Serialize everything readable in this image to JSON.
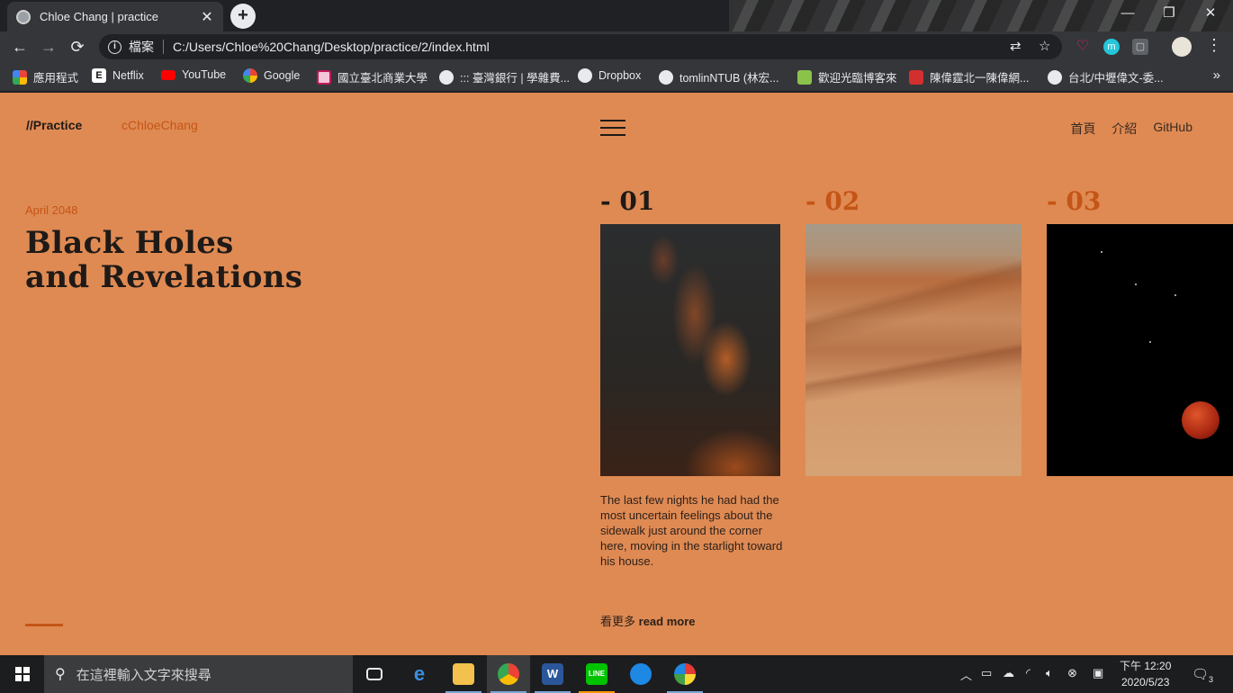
{
  "browser": {
    "tab_title": "Chloe Chang | practice",
    "tab_close": "✕",
    "new_tab": "+",
    "scheme_label": "檔案",
    "url": "C:/Users/Chloe%20Chang/Desktop/practice/2/index.html",
    "window_controls": {
      "minimize": "—",
      "restore": "❐",
      "close": "✕"
    },
    "nav": {
      "back": "←",
      "forward": "→",
      "reload": "⟳"
    },
    "omni_icons": {
      "translate": "⇄",
      "star": "☆"
    },
    "extensions": {
      "heart": "♡",
      "m": "m",
      "square": "▢",
      "menu": "⋮"
    },
    "bookmarks": [
      {
        "label": "應用程式",
        "icon": "apps-grid-icon",
        "color": "#e8453c"
      },
      {
        "label": "Netflix",
        "icon": "netflix-icon",
        "color": "#ffffff"
      },
      {
        "label": "YouTube",
        "icon": "youtube-icon",
        "color": "#ff0000"
      },
      {
        "label": "Google",
        "icon": "google-icon",
        "color": "#4285f4"
      },
      {
        "label": "國立臺北商業大學",
        "icon": "ntub-icon",
        "color": "#c2185b"
      },
      {
        "label": "::: 臺灣銀行 | 學雜費...",
        "icon": "globe-icon",
        "color": "#e8eaed"
      },
      {
        "label": "Dropbox",
        "icon": "globe-icon",
        "color": "#e8eaed"
      },
      {
        "label": "tomlinNTUB (林宏...",
        "icon": "github-icon",
        "color": "#e8eaed"
      },
      {
        "label": "歡迎光臨博客來",
        "icon": "books-icon",
        "color": "#8bc34a"
      },
      {
        "label": "陳偉霆北一陳偉網...",
        "icon": "bookmark-red-icon",
        "color": "#d32f2f"
      },
      {
        "label": "台北/中壢偉文-委...",
        "icon": "globe-icon",
        "color": "#e8eaed"
      }
    ],
    "bookmarks_more": "»"
  },
  "site": {
    "logo": "//Practice",
    "author": "cChloeChang",
    "nav": [
      "首頁",
      "介紹",
      "GitHub"
    ],
    "date": "April 2048",
    "headline_line1": "Black Holes",
    "headline_line2": "and Revelations",
    "cards": [
      {
        "number": "- 01",
        "image": "milky-way-galaxy",
        "number_color": "#1f1a17"
      },
      {
        "number": "- 02",
        "image": "desert-dunes",
        "number_color": "#c45516"
      },
      {
        "number": "- 03",
        "image": "blood-moon-space",
        "number_color": "#c45516"
      }
    ],
    "excerpt": "The last few nights he had had the most uncertain feelings about the sidewalk just around the corner here, moving in the starlight toward his house.",
    "readmore_cn": "看更多",
    "readmore_en": "read more",
    "colors": {
      "background": "#df8a53",
      "accent": "#c45516",
      "text": "#1f1a17"
    }
  },
  "taskbar": {
    "search_placeholder": "在這裡輸入文字來搜尋",
    "apps": [
      "task-view",
      "edge",
      "file-explorer",
      "chrome",
      "word",
      "line",
      "pen-app",
      "paint"
    ],
    "clock_period_time": "下午 12:20",
    "clock_date": "2020/5/23",
    "notifications": "3"
  }
}
